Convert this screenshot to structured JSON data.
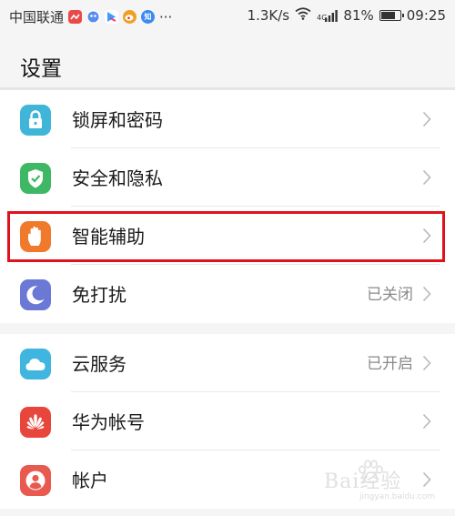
{
  "status_bar": {
    "carrier": "中国联通",
    "more_indicator": "···",
    "network_speed": "1.3K/s",
    "network_type": "4G",
    "battery_percent": "81%",
    "battery_level": 0.81,
    "time": "09:25",
    "notification_icons": [
      {
        "name": "messaging-app-icon",
        "color": "#e84a4a"
      },
      {
        "name": "game-app-icon",
        "color": "#5a8cf0"
      },
      {
        "name": "video-app-icon",
        "color": "#3aa0ff"
      },
      {
        "name": "weibo-icon",
        "color": "#f0a020"
      },
      {
        "name": "zhihu-icon",
        "color": "#3b8af0",
        "glyph": "知"
      }
    ]
  },
  "header": {
    "title": "设置"
  },
  "groups": [
    {
      "items": [
        {
          "label": "锁屏和密码",
          "value": "",
          "icon": "lock-icon",
          "color": "#3fb5d8"
        },
        {
          "label": "安全和隐私",
          "value": "",
          "icon": "shield-check-icon",
          "color": "#3fb866"
        },
        {
          "label": "智能辅助",
          "value": "",
          "icon": "hand-icon",
          "color": "#f07a2c",
          "highlighted": true
        },
        {
          "label": "免打扰",
          "value": "已关闭",
          "icon": "moon-icon",
          "color": "#6b78d6"
        }
      ]
    },
    {
      "items": [
        {
          "label": "云服务",
          "value": "已开启",
          "icon": "cloud-icon",
          "color": "#3fb5e0"
        },
        {
          "label": "华为帐号",
          "value": "",
          "icon": "huawei-logo-icon",
          "color": "#e8463c"
        },
        {
          "label": "帐户",
          "value": "",
          "icon": "user-icon",
          "color": "#e85a50"
        }
      ]
    }
  ],
  "watermark": {
    "text": "Bai经验",
    "sub": "jingyan.baidu.com"
  },
  "colors": {
    "highlight_border": "#e0121b",
    "background": "#f5f5f5",
    "row_background": "#ffffff",
    "secondary_text": "#8a8a8a"
  }
}
